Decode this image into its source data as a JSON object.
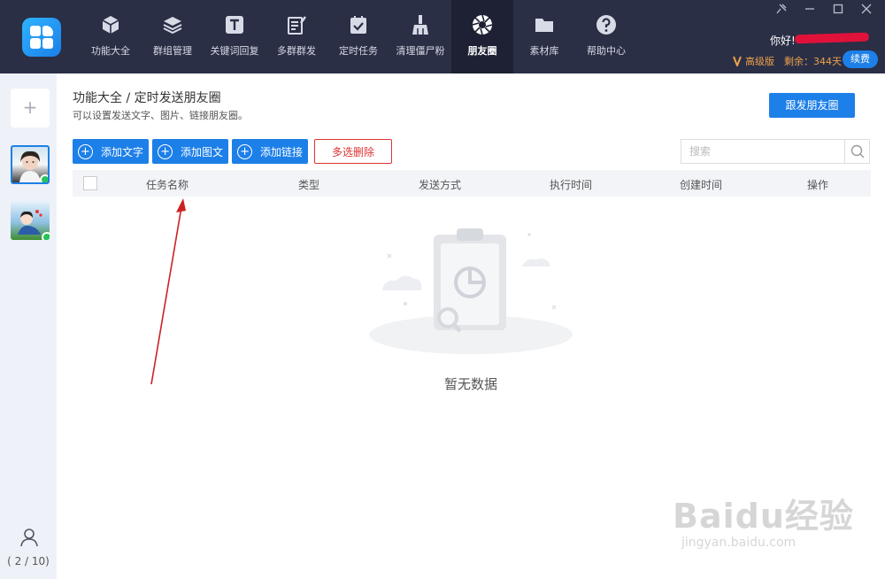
{
  "nav": {
    "items": [
      {
        "label": "功能大全",
        "icon": "cube-icon"
      },
      {
        "label": "群组管理",
        "icon": "layers-icon"
      },
      {
        "label": "关键词回复",
        "icon": "text-t-icon"
      },
      {
        "label": "多群群发",
        "icon": "edit-note-icon"
      },
      {
        "label": "定时任务",
        "icon": "calendar-check-icon"
      },
      {
        "label": "清理僵尸粉",
        "icon": "broom-icon"
      },
      {
        "label": "朋友圈",
        "icon": "aperture-icon",
        "active": true
      },
      {
        "label": "素材库",
        "icon": "folder-icon"
      },
      {
        "label": "帮助中心",
        "icon": "help-icon"
      }
    ]
  },
  "header": {
    "greeting": "你好!",
    "plan": "高级版",
    "remaining": "剩余：344天",
    "renew": "续费"
  },
  "sidebar": {
    "add": "+",
    "account_count": "( 2 / 10)"
  },
  "main": {
    "breadcrumb": "功能大全 / 定时发送朋友圈",
    "subtitle": "可以设置发送文字、图片、链接朋友圈。",
    "follow_button": "跟发朋友圈",
    "toolbar": {
      "add_text": "添加文字",
      "add_image_text": "添加图文",
      "add_link": "添加链接",
      "multi_delete": "多选删除"
    },
    "search_placeholder": "搜索",
    "columns": [
      "任务名称",
      "类型",
      "发送方式",
      "执行时间",
      "创建时间",
      "操作"
    ],
    "empty_text": "暂无数据"
  },
  "watermark": {
    "main": "Baidu经验",
    "sub": "jingyan.baidu.com"
  },
  "colors": {
    "topbar": "#2a2f46",
    "accent": "#1d7fe8",
    "danger": "#dd3333",
    "annotation_arrow": "#cc2222"
  }
}
